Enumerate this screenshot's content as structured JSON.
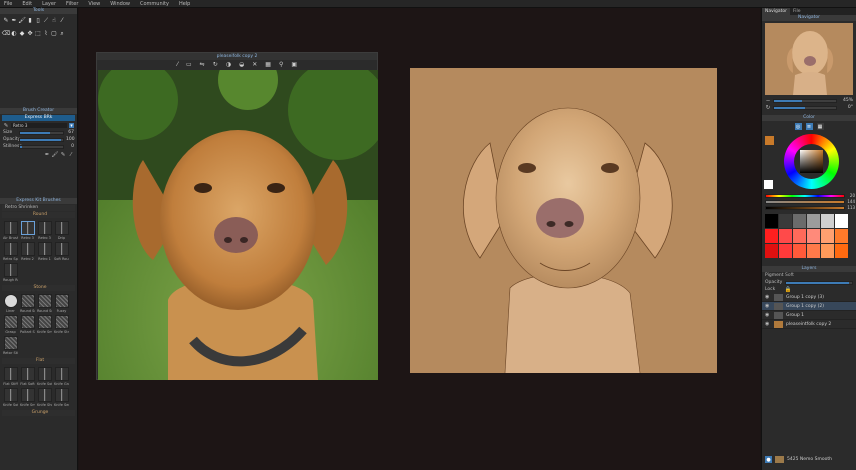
{
  "menu": [
    "File",
    "Edit",
    "Layer",
    "Filter",
    "View",
    "Window",
    "Community",
    "Help"
  ],
  "left_panel": {
    "tools_title": "Tools",
    "tool_icons": [
      "pencil-icon",
      "pen-icon",
      "brush-icon",
      "marker-icon",
      "airbrush-icon",
      "knife-icon",
      "smudge-icon",
      "eyedropper-icon"
    ],
    "tool_icons_row2": [
      "eraser-icon",
      "blend-icon",
      "fill-icon",
      "move-icon",
      "transform-icon",
      "lasso-icon",
      "select-icon",
      "zoom-icon"
    ],
    "brush_creator_title": "Brush Creator",
    "brush_preset_title": "Express BRk",
    "brush_name": "Retro 3",
    "size_label": "Size",
    "size_value": "67",
    "size_fraction": 0.7,
    "opacity_label": "Opacity",
    "opacity_value": "100",
    "opacity_fraction": 0.95,
    "stillness_label": "Stillness",
    "stillness_value": "0",
    "stillness_fraction": 0.05,
    "brushes_title": "Express Kit Brushes",
    "brushes_subtitle": "Retro Shrinken",
    "section_round": "Round",
    "round_brushes": [
      {
        "name": "Air Brush",
        "sel": false
      },
      {
        "name": "Retro 3",
        "sel": true
      },
      {
        "name": "Retro 3",
        "sel": false
      },
      {
        "name": "Drip",
        "sel": false
      },
      {
        "name": "Retro Spot",
        "sel": false
      },
      {
        "name": "Retro 2",
        "sel": false
      },
      {
        "name": "Retro 1",
        "sel": false
      },
      {
        "name": "Soft Round 2",
        "sel": false
      },
      {
        "name": "Rough Round",
        "sel": false
      }
    ],
    "section_stone": "Stone",
    "stone_brushes": [
      {
        "name": "Liner",
        "style": "round"
      },
      {
        "name": "Round Soft",
        "style": "tex"
      },
      {
        "name": "Round Soft",
        "style": "tex"
      },
      {
        "name": "Fuzzy",
        "style": "tex"
      },
      {
        "name": "Grasp",
        "style": "tex"
      },
      {
        "name": "Poltart Smooth",
        "style": "tex"
      },
      {
        "name": "Knife Smea",
        "style": "tex"
      },
      {
        "name": "Knife Streg",
        "style": "tex"
      },
      {
        "name": "Retor Stiph",
        "style": "tex"
      }
    ],
    "section_flat": "Flat",
    "flat_brushes": [
      {
        "name": "Flat Stiff"
      },
      {
        "name": "Flat Soft"
      },
      {
        "name": "Knife Soft"
      },
      {
        "name": "Knife Grainy"
      },
      {
        "name": "Knife Soft"
      },
      {
        "name": "Knife Smooth"
      },
      {
        "name": "Knife Shop"
      },
      {
        "name": "Knife Sedu"
      }
    ],
    "section_grunge": "Grunge"
  },
  "reference": {
    "title": "pleaseifolk copy 2",
    "toolbar_icons": [
      "eyedropper-icon",
      "fit-icon",
      "flip-icon",
      "rotate-icon",
      "grayscale-icon",
      "contrast-icon",
      "reset-icon",
      "grid-icon",
      "pin-icon",
      "image-icon"
    ]
  },
  "right_panel": {
    "navigator_tabs": [
      "Navigator",
      "File"
    ],
    "navigator_title": "Navigator",
    "zoom_value": "45%",
    "rotation_value": "0°",
    "color_title": "Color",
    "hue_value": "20",
    "sat_value": "144",
    "val_value": "113",
    "swatches": [
      "#000000",
      "#3a3a3a",
      "#6b6b6b",
      "#9c9c9c",
      "#cfcfcf",
      "#ffffff",
      "#ff1f1f",
      "#ff4a4a",
      "#ff6a5a",
      "#ff8a7a",
      "#ffa070",
      "#ff7a2a",
      "#e01010",
      "#ff3a3a",
      "#ff5a3a",
      "#ff7a4a",
      "#ff9a5a",
      "#ff6a10"
    ],
    "layers_title": "Layers",
    "pigment_label": "Pigment",
    "pigment_value": "Soft",
    "opacity_label": "Opacity",
    "lock_label": "Lock",
    "layers": [
      {
        "name": "Group 1 copy (3)",
        "sel": false
      },
      {
        "name": "Group 1 copy (2)",
        "sel": true
      },
      {
        "name": "Group 1",
        "sel": false
      },
      {
        "name": "pleaseintfolk copy 2",
        "sel": false
      }
    ],
    "bottom_brush": "5425 Nemo Smooth"
  },
  "colors": {
    "accent": "#3d7bb6",
    "paper": "#b58a5e"
  }
}
